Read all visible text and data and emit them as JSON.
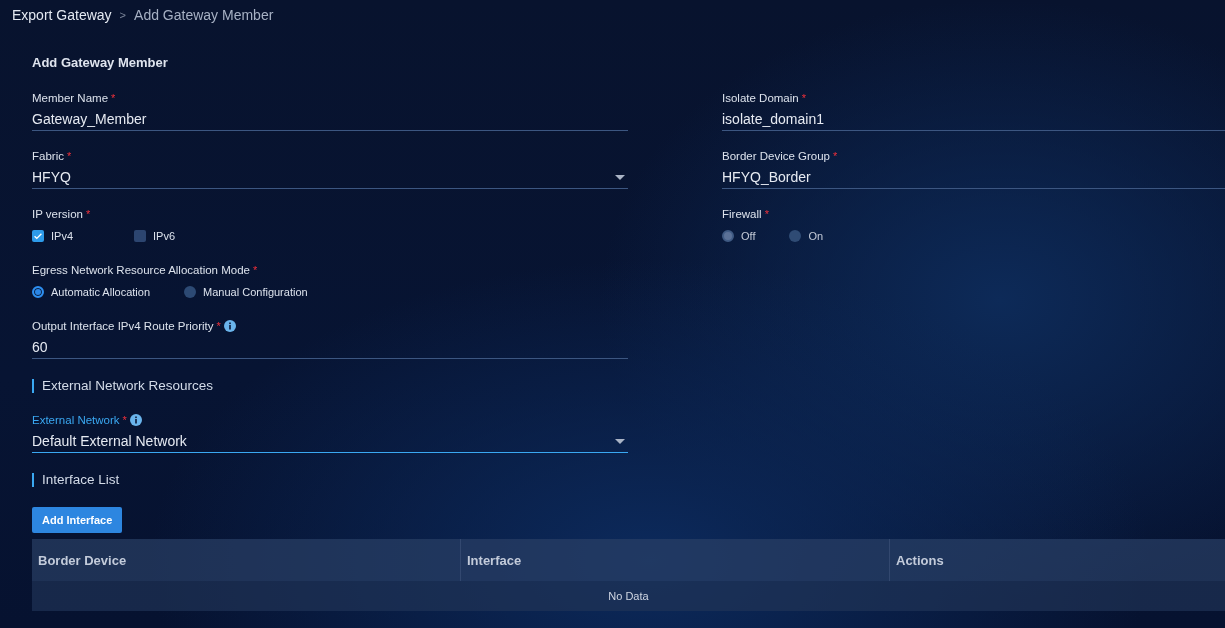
{
  "breadcrumb": [
    {
      "label": "Export Gateway",
      "current": false
    },
    {
      "label": "Add Gateway Member",
      "current": true
    }
  ],
  "breadcrumb_separator": ">",
  "form": {
    "title": "Add Gateway Member",
    "required_mark": "*",
    "items": [
      {
        "kind": "row",
        "fields": [
          {
            "kind": "text",
            "label": "Member Name",
            "required": true,
            "value": "Gateway_Member"
          },
          {
            "kind": "text",
            "label": "Isolate Domain",
            "required": true,
            "value": "isolate_domain1"
          }
        ]
      },
      {
        "kind": "row",
        "fields": [
          {
            "kind": "select",
            "label": "Fabric",
            "required": true,
            "value": "HFYQ"
          },
          {
            "kind": "text",
            "label": "Border Device Group",
            "required": true,
            "value": "HFYQ_Border"
          }
        ]
      },
      {
        "kind": "row",
        "fields": [
          {
            "kind": "checkbox",
            "label": "IP version",
            "required": true,
            "options": [
              {
                "label": "IPv4",
                "checked": true
              },
              {
                "label": "IPv6",
                "checked": false
              }
            ]
          },
          {
            "kind": "radio",
            "label": "Firewall",
            "required": true,
            "disabled": true,
            "options": [
              {
                "label": "Off",
                "selected": true
              },
              {
                "label": "On",
                "selected": false
              }
            ]
          }
        ]
      },
      {
        "kind": "row",
        "fields": [
          {
            "kind": "radio",
            "label": "Egress Network Resource Allocation Mode",
            "required": true,
            "disabled": false,
            "options": [
              {
                "label": "Automatic Allocation",
                "selected": true
              },
              {
                "label": "Manual Configuration",
                "selected": false
              }
            ]
          }
        ]
      },
      {
        "kind": "row",
        "fields": [
          {
            "kind": "text",
            "label": "Output Interface IPv4 Route Priority",
            "required": true,
            "info": true,
            "value": "60"
          }
        ]
      },
      {
        "kind": "section",
        "title": "External Network Resources"
      },
      {
        "kind": "row",
        "fields": [
          {
            "kind": "select",
            "label": "External Network",
            "required": true,
            "info": true,
            "focused": true,
            "value": "Default External Network"
          }
        ]
      },
      {
        "kind": "section",
        "title": "Interface List"
      },
      {
        "kind": "button",
        "label": "Add Interface"
      },
      {
        "kind": "table",
        "columns": [
          "Border Device",
          "Interface",
          "Actions"
        ],
        "empty_text": "No Data"
      }
    ]
  }
}
